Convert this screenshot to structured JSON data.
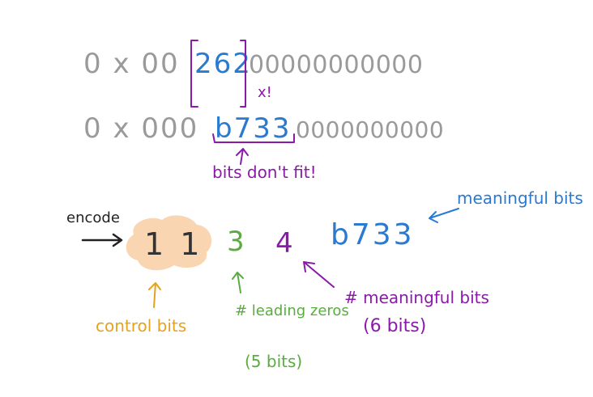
{
  "row1": {
    "prefix": "0 x 00",
    "highlight": "262",
    "suffix": "00000000000",
    "mark": "x!"
  },
  "row2": {
    "prefix": "0 x 000",
    "highlight": "b733",
    "suffix": "0000000000"
  },
  "note_bits_dont_fit": "bits don't fit!",
  "encode_label": "encode",
  "encoded": {
    "control": "1 1",
    "leading": "3",
    "meaningful_count": "4",
    "meaningful_value": "b733"
  },
  "labels": {
    "meaningful_bits": "meaningful bits",
    "control_bits": "control bits",
    "leading_zeros": "# leading zeros",
    "leading_zeros_size": "(5 bits)",
    "meaningful_count": "# meaningful bits",
    "meaningful_count_size": "(6 bits)"
  },
  "colors": {
    "gray": "#9a9a9a",
    "blue": "#2a7ad1",
    "purple": "#8a1aa8",
    "green": "#58ad3e",
    "orange": "#e5a21f",
    "peach": "#f9d5b2",
    "black": "#222222"
  }
}
